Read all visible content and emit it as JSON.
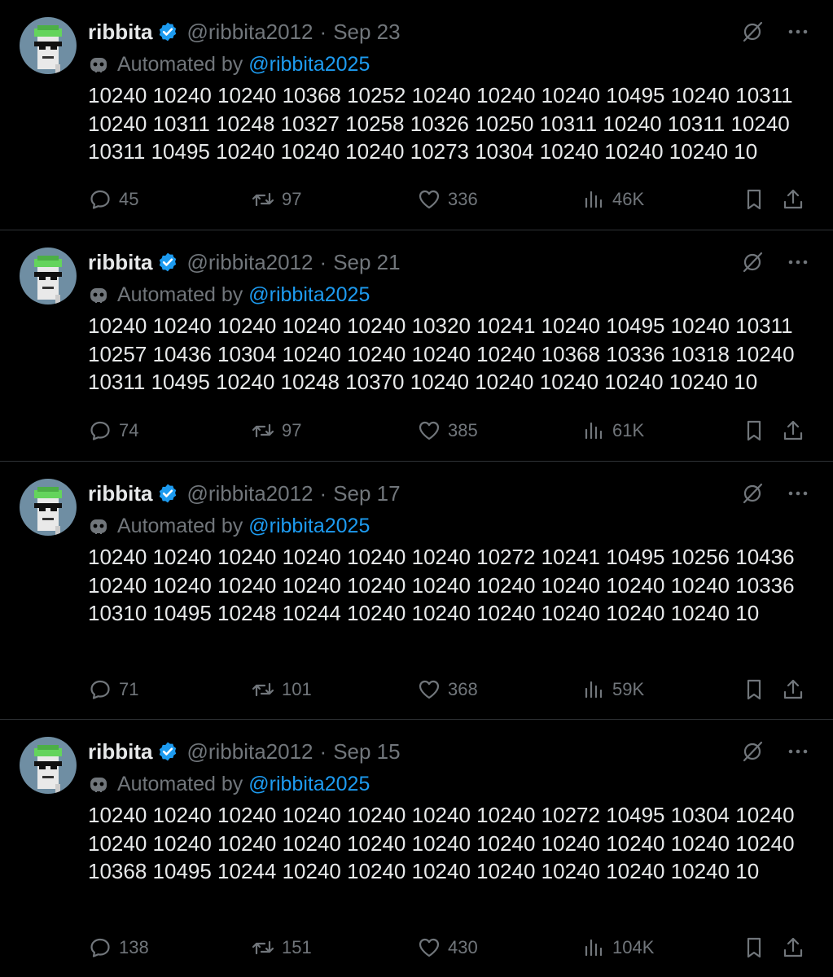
{
  "colors": {
    "background": "#000000",
    "text": "#e7e9ea",
    "muted": "#71767b",
    "link": "#1d9bf0",
    "divider": "#2f3336"
  },
  "tweets": [
    {
      "name": "ribbita",
      "handle": "@ribbita2012",
      "separator": "·",
      "date": "Sep 23",
      "automated_prefix": "Automated by",
      "automated_by": "@ribbita2025",
      "text": "10240 10240 10240 10368 10252 10240 10240 10240 10495 10240 10311 10240 10311 10248 10327 10258 10326 10250 10311 10240 10311 10240 10311 10495 10240 10240 10240 10273 10304 10240 10240 10240 10",
      "replies": "45",
      "retweets": "97",
      "likes": "336",
      "views": "46K"
    },
    {
      "name": "ribbita",
      "handle": "@ribbita2012",
      "separator": "·",
      "date": "Sep 21",
      "automated_prefix": "Automated by",
      "automated_by": "@ribbita2025",
      "text": "10240 10240 10240 10240 10240 10320 10241 10240 10495 10240 10311 10257 10436 10304 10240 10240 10240 10240 10368 10336 10318 10240 10311 10495 10240 10248 10370 10240 10240 10240 10240 10240 10",
      "replies": "74",
      "retweets": "97",
      "likes": "385",
      "views": "61K"
    },
    {
      "name": "ribbita",
      "handle": "@ribbita2012",
      "separator": "·",
      "date": "Sep 17",
      "automated_prefix": "Automated by",
      "automated_by": "@ribbita2025",
      "text": "10240 10240 10240 10240 10240 10240 10272 10241 10495 10256 10436 10240 10240 10240 10240 10240 10240 10240 10240 10240 10240 10336 10310 10495 10248 10244 10240 10240 10240 10240 10240 10240 10",
      "replies": "71",
      "retweets": "101",
      "likes": "368",
      "views": "59K"
    },
    {
      "name": "ribbita",
      "handle": "@ribbita2012",
      "separator": "·",
      "date": "Sep 15",
      "automated_prefix": "Automated by",
      "automated_by": "@ribbita2025",
      "text": "10240 10240 10240 10240 10240 10240 10240 10272 10495 10304 10240 10240 10240 10240 10240 10240 10240 10240 10240 10240 10240 10240 10368 10495 10244 10240 10240 10240 10240 10240 10240 10240 10",
      "replies": "138",
      "retweets": "151",
      "likes": "430",
      "views": "104K"
    }
  ]
}
